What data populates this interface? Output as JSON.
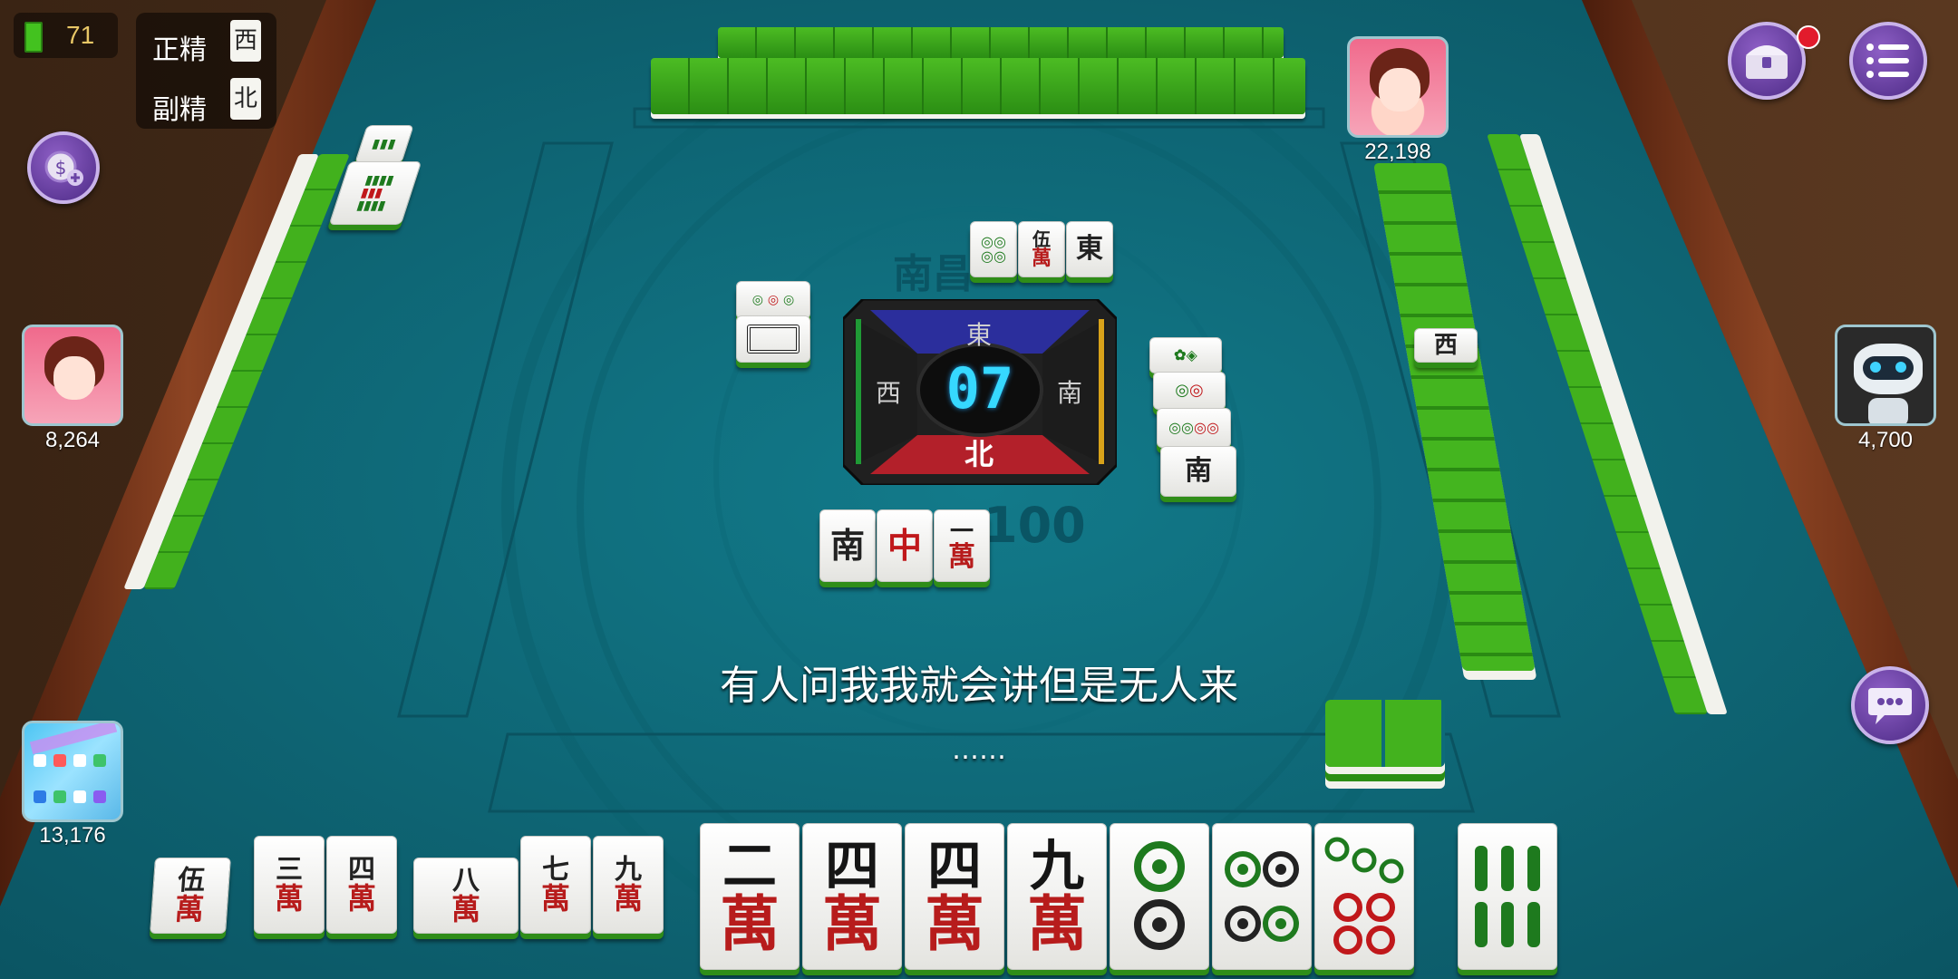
{
  "hud": {
    "battery_level": "71",
    "wild": [
      {
        "label": "正精",
        "tile": "西"
      },
      {
        "label": "副精",
        "tile": "北"
      }
    ]
  },
  "players": {
    "top": {
      "score": "22,198"
    },
    "left": {
      "score": "8,264"
    },
    "right": {
      "score": "4,700"
    },
    "self": {
      "score": "13,176"
    }
  },
  "table": {
    "region": "南昌",
    "base": "100"
  },
  "compass": {
    "timer": "07",
    "seats": {
      "top": "東",
      "left": "西",
      "right": "南",
      "bottom": "北"
    }
  },
  "discards": {
    "self": [
      {
        "t1": "南",
        "t2": ""
      },
      {
        "t1": "中",
        "t2": ""
      },
      {
        "t1": "一",
        "t2": "萬"
      }
    ],
    "top_text": [
      {
        "t1": "伍",
        "t2": "萬"
      },
      {
        "t1": "東",
        "t2": ""
      }
    ],
    "right_text": [
      {
        "t1": "南",
        "t2": ""
      }
    ],
    "right_tile": "西"
  },
  "melds": [
    {
      "t1": "伍",
      "t2": "萬"
    },
    {
      "t1": "三",
      "t2": "萬"
    },
    {
      "t1": "四",
      "t2": "萬"
    },
    {
      "t1": "八",
      "t2": "萬"
    },
    {
      "t1": "七",
      "t2": "萬"
    },
    {
      "t1": "九",
      "t2": "萬"
    }
  ],
  "hand": [
    {
      "t1": "二",
      "t2": "萬"
    },
    {
      "t1": "四",
      "t2": "萬"
    },
    {
      "t1": "四",
      "t2": "萬"
    },
    {
      "t1": "九",
      "t2": "萬"
    }
  ],
  "subtitle": {
    "line": "有人问我我就会讲但是无人来",
    "dots": "……"
  },
  "colors": {
    "felt": "#0f6b7a",
    "tile_back": "#3aa71b",
    "wood": "#7a3d1e",
    "button_purple": "#5b3597"
  },
  "icons": [
    "battery-icon",
    "coin-plus-icon",
    "treasure-chest-icon",
    "menu-list-icon",
    "chat-bubble-icon"
  ]
}
